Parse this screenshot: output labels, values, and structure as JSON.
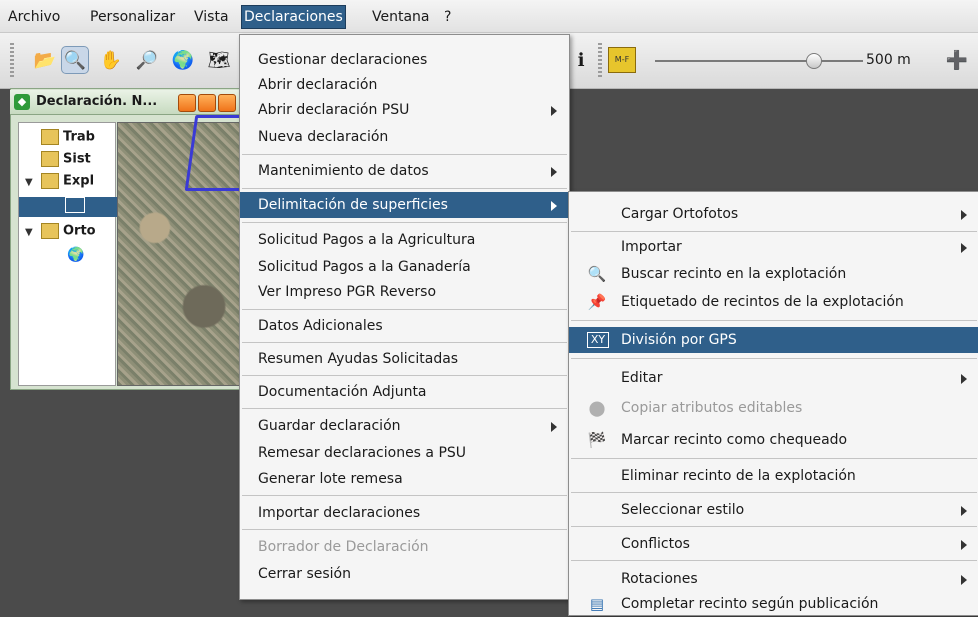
{
  "menubar": {
    "items": [
      "Archivo",
      "Personalizar",
      "Vista",
      "Declaraciones",
      "Ventana",
      "?"
    ]
  },
  "toolbar": {
    "scale_label": "500 m",
    "mf_label": "M-F"
  },
  "frame": {
    "title": "Declaración. N..."
  },
  "tree": {
    "items": [
      "Trab",
      "Sist",
      "Expl",
      "Orto"
    ]
  },
  "declaraciones_menu": {
    "items": [
      {
        "label": "Gestionar declaraciones"
      },
      {
        "label": "Abrir declaración"
      },
      {
        "label": "Abrir declaración PSU"
      },
      {
        "label": "Nueva declaración"
      },
      {
        "label": "Mantenimiento de datos"
      },
      {
        "label": "Delimitación de superficies"
      },
      {
        "label": "Solicitud Pagos a la Agricultura"
      },
      {
        "label": "Solicitud Pagos a la Ganadería"
      },
      {
        "label": "Ver Impreso PGR Reverso"
      },
      {
        "label": "Datos Adicionales"
      },
      {
        "label": "Resumen Ayudas Solicitadas"
      },
      {
        "label": "Documentación Adjunta"
      },
      {
        "label": "Guardar declaración"
      },
      {
        "label": "Remesar declaraciones a PSU"
      },
      {
        "label": "Generar lote remesa"
      },
      {
        "label": "Importar declaraciones"
      },
      {
        "label": "Borrador de Declaración"
      },
      {
        "label": "Cerrar sesión"
      }
    ]
  },
  "delimitacion_submenu": {
    "items": [
      {
        "label": "Cargar Ortofotos"
      },
      {
        "label": "Importar"
      },
      {
        "label": "Buscar recinto en la explotación",
        "icon": "magnifier-icon"
      },
      {
        "label": "Etiquetado de recintos de la explotación",
        "icon": "pushpin-icon"
      },
      {
        "label": "División por GPS",
        "icon": "xy-icon"
      },
      {
        "label": "Editar"
      },
      {
        "label": "Copiar atributos editables",
        "icon": "disabled-circle-icon"
      },
      {
        "label": "Marcar recinto como chequeado",
        "icon": "checkered-flag-icon"
      },
      {
        "label": "Eliminar recinto de la explotación"
      },
      {
        "label": "Seleccionar estilo"
      },
      {
        "label": "Conflictos"
      },
      {
        "label": "Rotaciones"
      },
      {
        "label": "Completar recinto según publicación",
        "icon": "document-list-icon"
      }
    ]
  },
  "colors": {
    "highlight": "#2f5f8a",
    "menu_bg": "#f5f5f5",
    "disabled_text": "#9a9a9a"
  }
}
